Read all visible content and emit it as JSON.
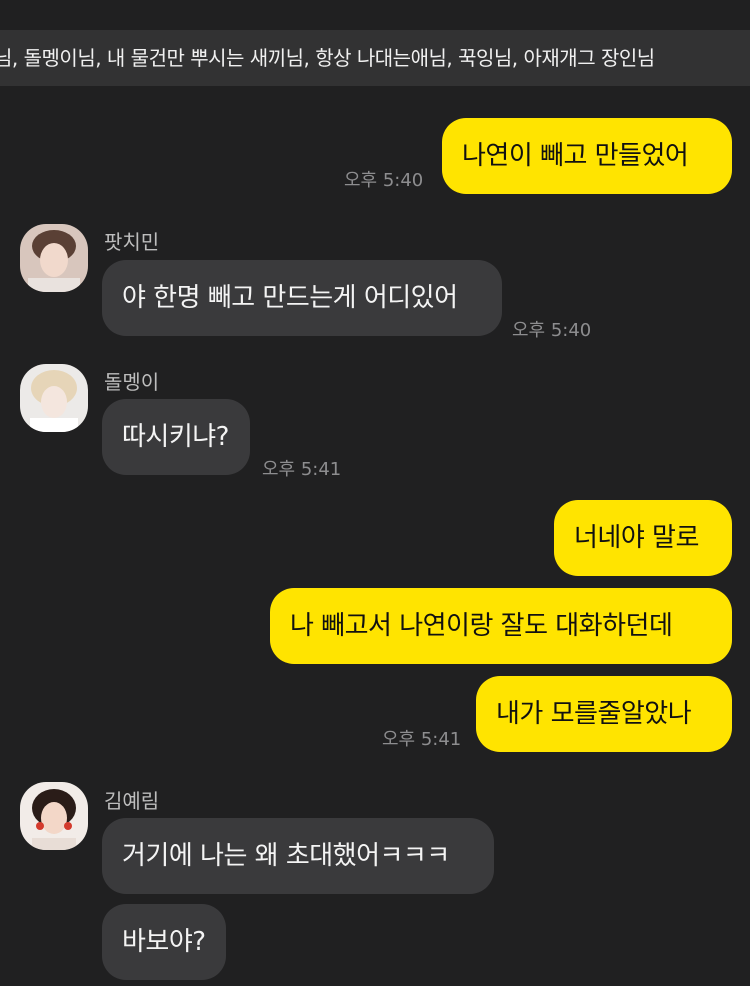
{
  "room": {
    "members_line": "님, 돌멩이님, 내 물건만 뿌시는 새끼님, 항상 나대는애님, 꾹잉님, 아재개그 장인님"
  },
  "messages": [
    {
      "from": "me",
      "text": "나연이 빼고 만들었어",
      "time": "오후 5:40"
    },
    {
      "from": "팟치민",
      "text": "야 한명 빼고 만드는게 어디있어",
      "time": "오후 5:40"
    },
    {
      "from": "돌멩이",
      "text": "따시키냐?",
      "time": "오후 5:41"
    },
    {
      "from": "me",
      "text": "너네야 말로"
    },
    {
      "from": "me",
      "text": "나 빼고서 나연이랑 잘도 대화하던데"
    },
    {
      "from": "me",
      "text": "내가 모를줄알았나",
      "time": "오후 5:41"
    },
    {
      "from": "김예림",
      "text": "거기에 나는 왜 초대했어ㅋㅋㅋ"
    },
    {
      "from": "김예림",
      "text": "바보야?"
    }
  ],
  "senders": {
    "s1": "팟치민",
    "s2": "돌멩이",
    "s3": "김예림"
  },
  "colors": {
    "background": "#202021",
    "my_bubble": "#FFE400",
    "their_bubble": "#3a3a3c",
    "timestamp": "#8d8d8f"
  }
}
